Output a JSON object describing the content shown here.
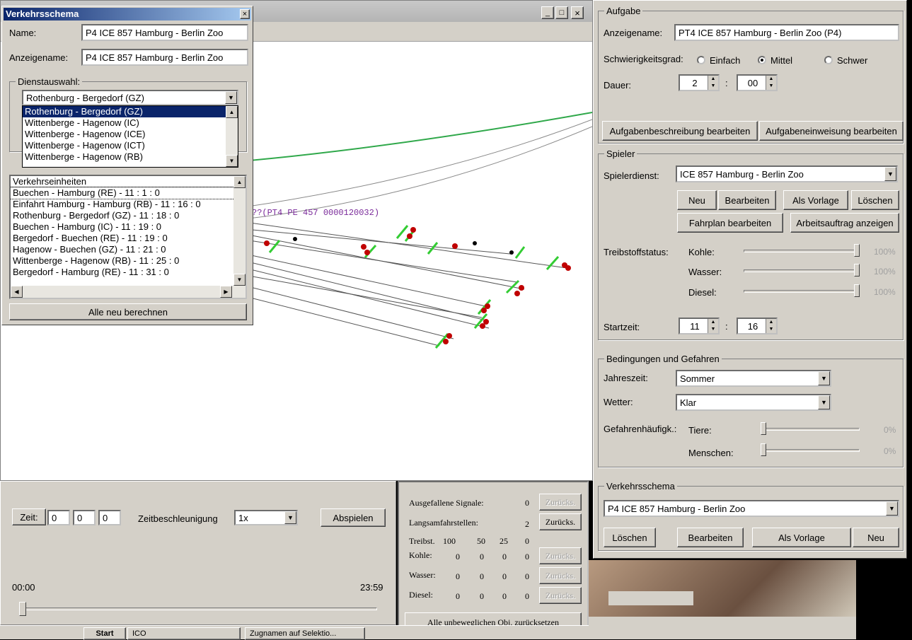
{
  "colors": {
    "titlebar": "#0a246a",
    "track_green": "#2fa84a",
    "signal_red": "#c00000",
    "signal_green": "#33cc33",
    "label_purple": "#7a2a9a"
  },
  "main_window": {
    "caption_buttons": [
      "_",
      "□",
      "×"
    ],
    "track_label": "??(PT4 PE 457 0000120032)"
  },
  "scheme_dialog": {
    "title": "Verkehrsschema",
    "close": "×",
    "name_label": "Name:",
    "name_value": "P4 ICE 857 Hamburg - Berlin Zoo",
    "display_label": "Anzeigename:",
    "display_value": "P4 ICE 857 Hamburg - Berlin Zoo",
    "service_group": "Dienstauswahl:",
    "service_selected": "Rothenburg - Bergedorf (GZ)",
    "service_options": [
      "Rothenburg - Bergedorf (GZ)",
      "Wittenberge - Hagenow (IC)",
      "Wittenberge - Hagenow (ICE)",
      "Wittenberge - Hagenow (ICT)",
      "Wittenberge - Hagenow (RB)"
    ],
    "units_header": "Verkehrseinheiten",
    "units": [
      "Buechen - Hamburg (RE) - 11 : 1 : 0",
      "Einfahrt Hamburg - Hamburg (RB) - 11 : 16 : 0",
      "Rothenburg - Bergedorf (GZ) - 11 : 18 : 0",
      "Buechen - Hamburg (IC) - 11 : 19 : 0",
      "Bergedorf - Buechen (RE) - 11 : 19 : 0",
      "Hagenow - Buechen (GZ) - 11 : 21 : 0",
      "Wittenberge - Hagenow (RB) - 11 : 25 : 0",
      "Bergedorf - Hamburg (RE) - 11 : 31 : 0"
    ],
    "recalc_button": "Alle neu berechnen"
  },
  "bottom_left": {
    "time_button": "Zeit:",
    "time_h": "0",
    "time_m": "0",
    "time_s": "0",
    "accel_label": "Zeitbeschleunigung",
    "accel_value": "1x",
    "play_button": "Abspielen",
    "time_start": "00:00",
    "time_end": "23:59"
  },
  "stats_panel": {
    "failed_signals": "Ausgefallene Signale:",
    "failed_value": "0",
    "slow_sections": "Langsamfahrstellen:",
    "slow_value": "2",
    "reset": "Zurücks.",
    "fuel_header": [
      "Treibst.",
      "100",
      "50",
      "25",
      "0"
    ],
    "rows": [
      {
        "name": "Kohle:",
        "v": [
          "0",
          "0",
          "0",
          "0"
        ]
      },
      {
        "name": "Wasser:",
        "v": [
          "0",
          "0",
          "0",
          "0"
        ]
      },
      {
        "name": "Diesel:",
        "v": [
          "0",
          "0",
          "0",
          "0"
        ]
      }
    ],
    "reset_all": "Alle unbeweglichen Obj. zurücksetzen"
  },
  "task": {
    "group": "Aufgabe",
    "display_label": "Anzeigename:",
    "display_value": "PT4 ICE 857 Hamburg - Berlin Zoo (P4)",
    "difficulty_label": "Schwierigkeitsgrad:",
    "easy": "Einfach",
    "medium": "Mittel",
    "hard": "Schwer",
    "duration_label": "Dauer:",
    "duration_h": "2",
    "duration_m": "00",
    "edit_desc": "Aufgabenbeschreibung bearbeiten",
    "edit_briefing": "Aufgabeneinweisung bearbeiten"
  },
  "player": {
    "group": "Spieler",
    "service_label": "Spielerdienst:",
    "service_value": "ICE 857 Hamburg - Berlin Zoo",
    "new": "Neu",
    "edit": "Bearbeiten",
    "template": "Als Vorlage",
    "delete": "Löschen",
    "timetable": "Fahrplan bearbeiten",
    "work_order": "Arbeitsauftrag anzeigen",
    "fuel_label": "Treibstoffstatus:",
    "coal": "Kohle:",
    "water": "Wasser:",
    "diesel": "Diesel:",
    "coal_pct": "100%",
    "water_pct": "100%",
    "diesel_pct": "100%",
    "start_label": "Startzeit:",
    "start_h": "11",
    "start_m": "16"
  },
  "conditions": {
    "group": "Bedingungen und Gefahren",
    "season_label": "Jahreszeit:",
    "season_value": "Sommer",
    "weather_label": "Wetter:",
    "weather_value": "Klar",
    "hazard_label": "Gefahrenhäufigk.:",
    "animals": "Tiere:",
    "people": "Menschen:",
    "animals_pct": "0%",
    "people_pct": "0%"
  },
  "scheme_group": {
    "group": "Verkehrsschema",
    "value": "P4 ICE 857 Hamburg - Berlin Zoo",
    "delete": "Löschen",
    "edit": "Bearbeiten",
    "template": "Als Vorlage",
    "new": "Neu"
  },
  "taskbar": {
    "start": "Start",
    "item1": "ICO",
    "item2": "Zugnamen auf Selektio..."
  }
}
